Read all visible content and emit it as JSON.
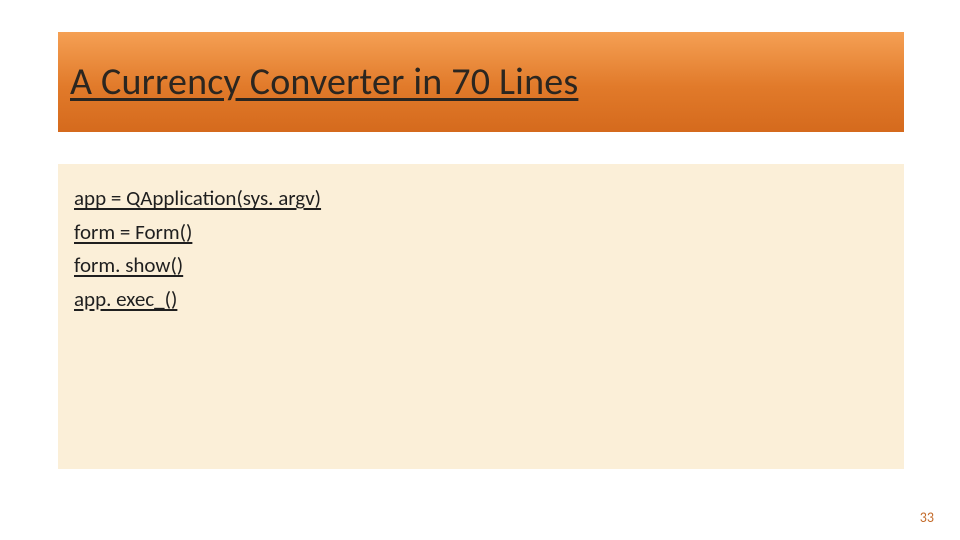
{
  "slide": {
    "title": "A Currency Converter in 70 Lines",
    "code_lines": [
      "app = QApplication(sys. argv)",
      "form = Form()",
      "form. show()",
      "app. exec_()"
    ],
    "page_number": "33"
  }
}
